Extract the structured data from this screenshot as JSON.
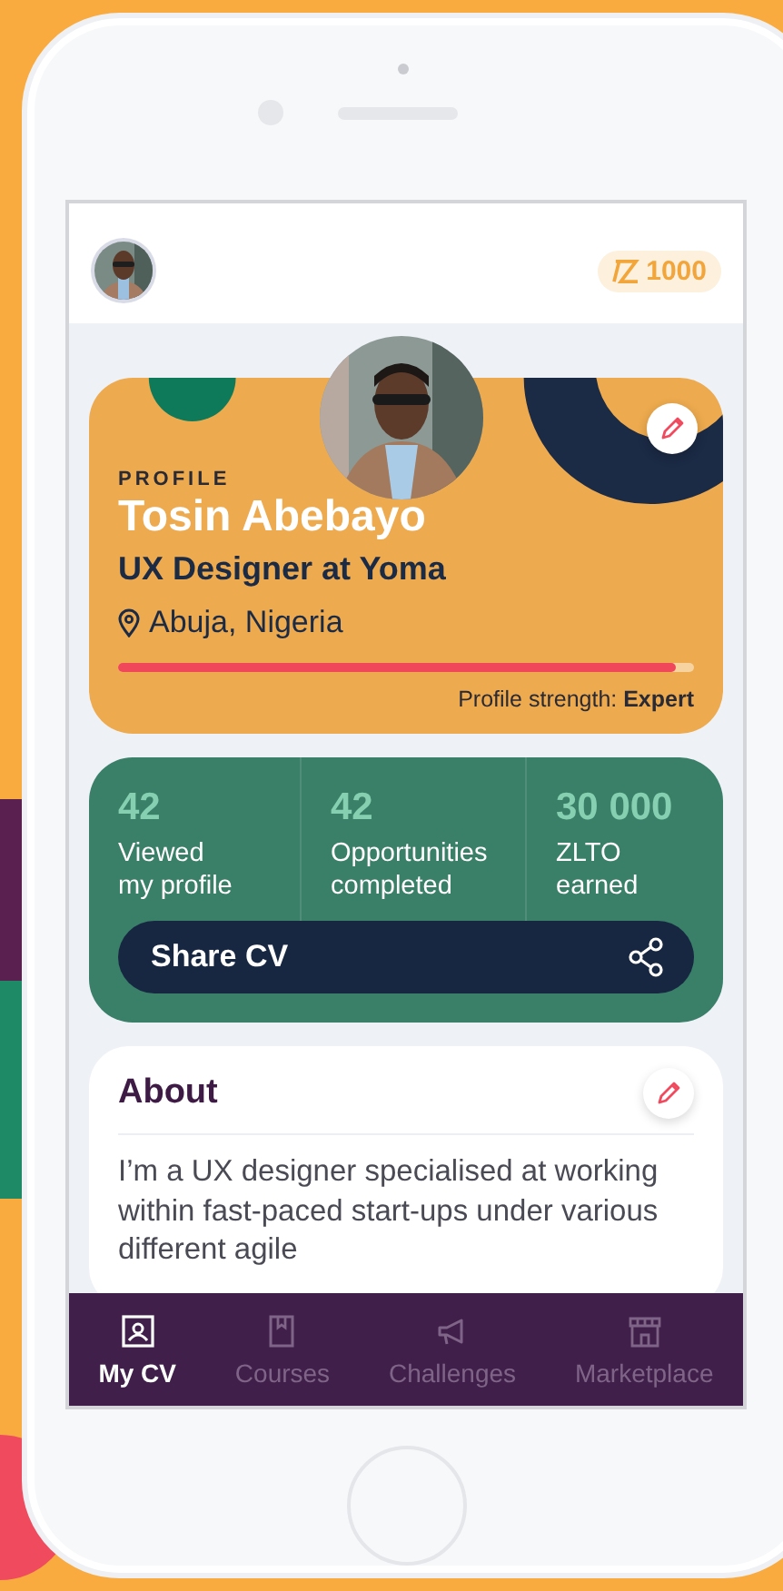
{
  "header": {
    "points": "1000"
  },
  "profile": {
    "label": "PROFILE",
    "name": "Tosin Abebayo",
    "title": "UX Designer at Yoma",
    "location": "Abuja, Nigeria",
    "level": 0.97,
    "strength": "Profile strength: **Expert**"
  },
  "stats": [
    {
      "value": "42",
      "label": "Viewed\nmy profile"
    },
    {
      "value": "42",
      "label": "Opportunities\ncompleted"
    },
    {
      "value": "30 000",
      "label": "ZLTO\nearned"
    }
  ],
  "share_button": "Share CV",
  "about": {
    "title": "About",
    "text": "I’m a UX designer specialised at working within fast-paced start-ups under various different agile"
  },
  "nav": [
    {
      "label": "My CV",
      "selected": true
    },
    {
      "label": "Courses",
      "selected": false
    },
    {
      "label": "Challenges",
      "selected": false
    },
    {
      "label": "Marketplace",
      "selected": false
    }
  ]
}
